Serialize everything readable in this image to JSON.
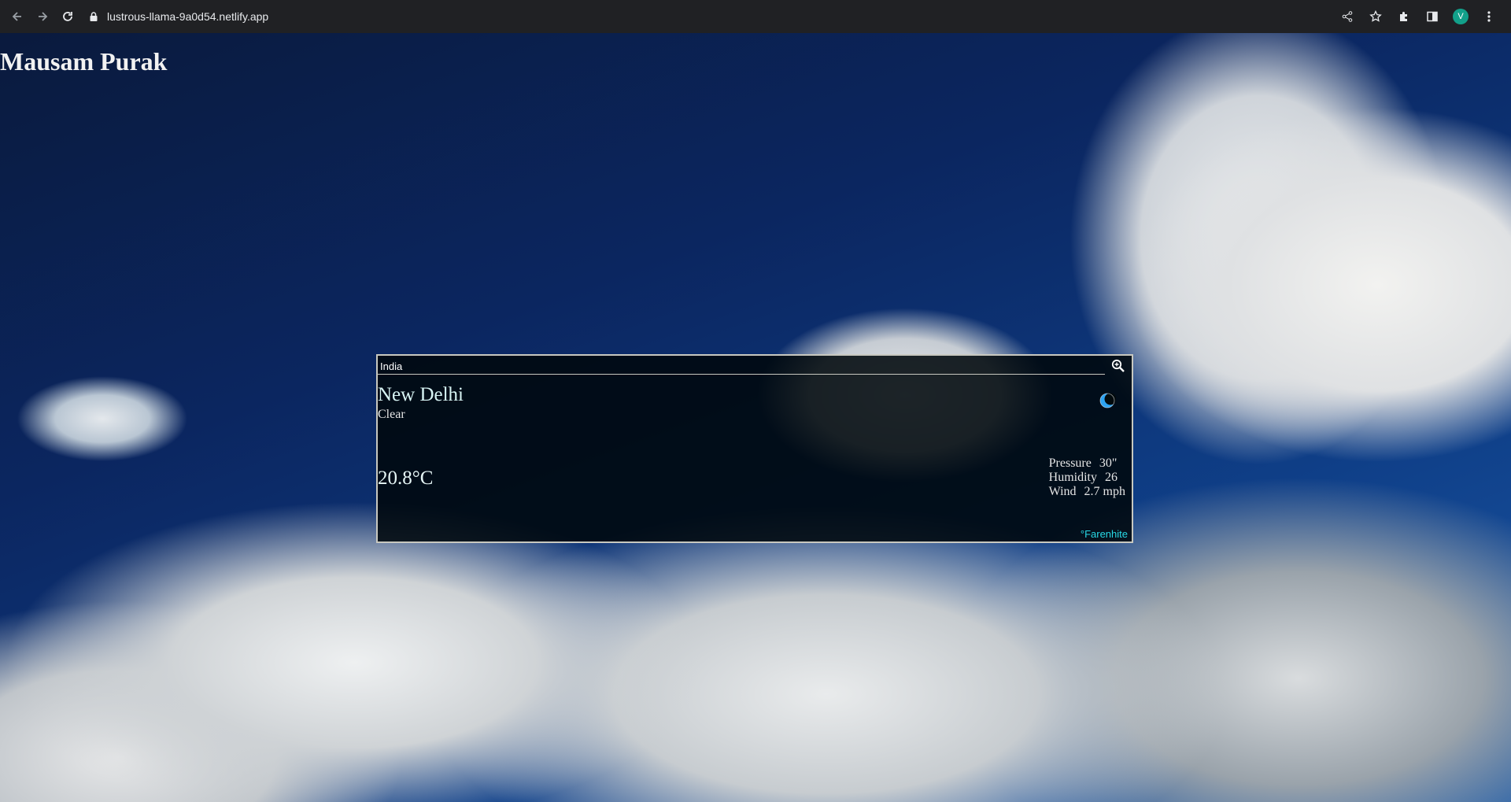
{
  "browser": {
    "url": "lustrous-llama-9a0d54.netlify.app",
    "profile_initial": "V"
  },
  "page": {
    "title": "Mausam Purak"
  },
  "search": {
    "value": "India"
  },
  "weather": {
    "city": "New Delhi",
    "condition": "Clear",
    "temperature": "20.8°C",
    "icon": "moon-icon",
    "pressure_label": "Pressure",
    "pressure_value": "30\"",
    "humidity_label": "Humidity",
    "humidity_value": "26",
    "wind_label": "Wind",
    "wind_value": "2.7 mph",
    "unit_toggle": "°Farenhite"
  },
  "colors": {
    "city": "#d7f3f3",
    "unit_toggle": "#28d9e6",
    "moon": "#2ea3f2"
  }
}
